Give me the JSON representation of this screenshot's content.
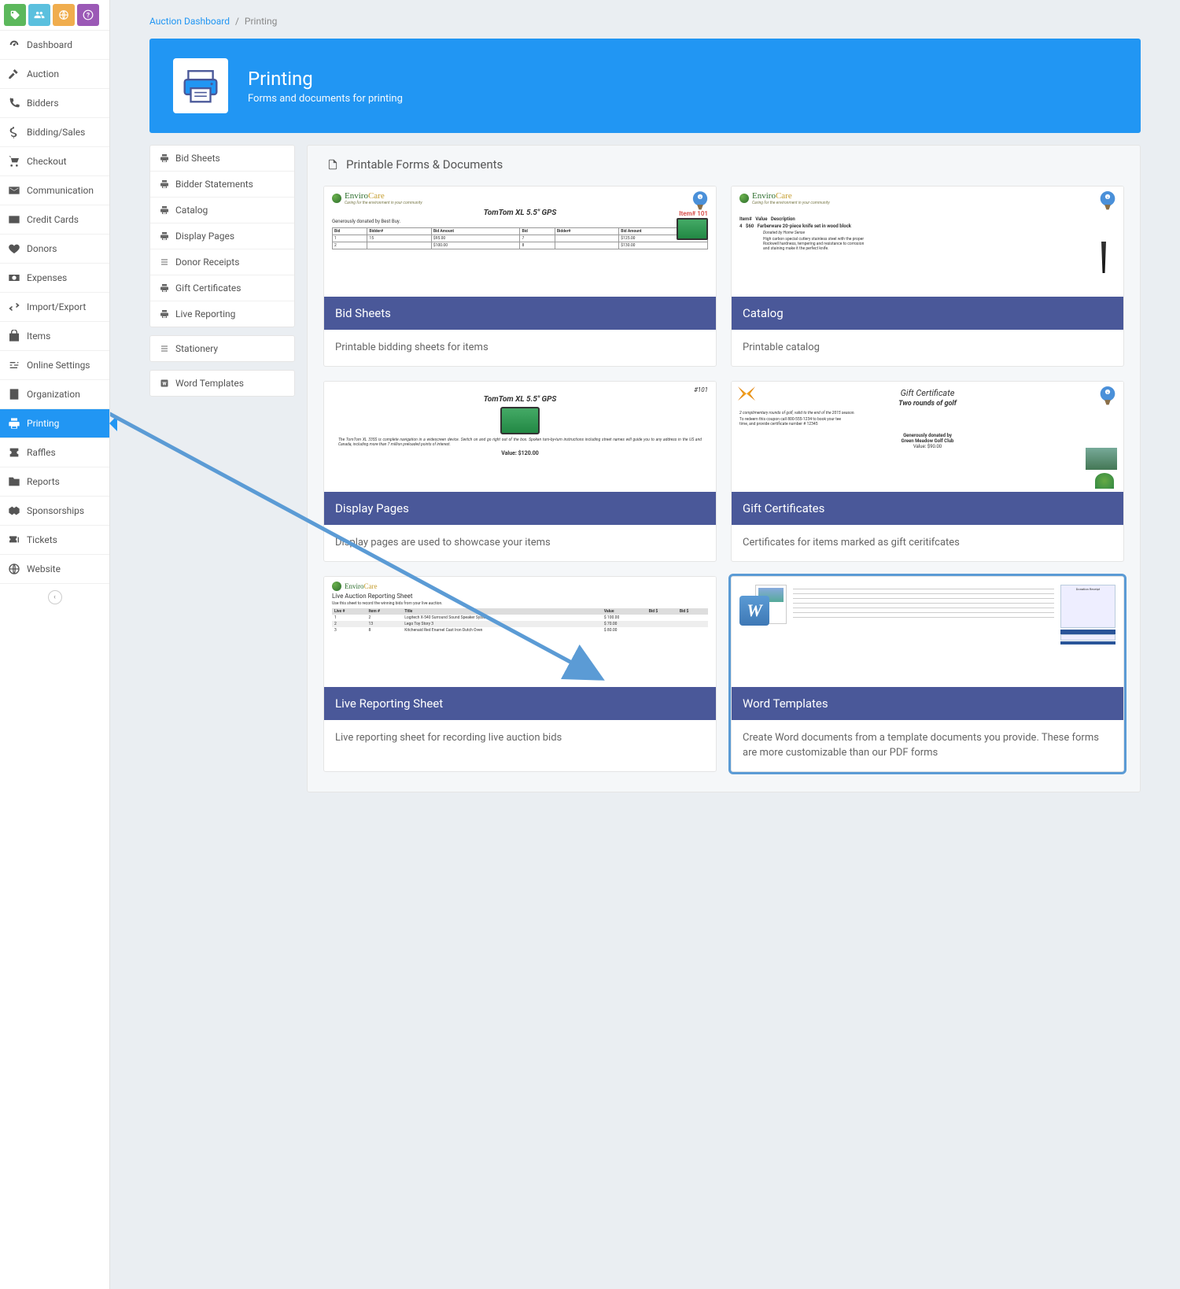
{
  "breadcrumb": {
    "root": "Auction Dashboard",
    "current": "Printing"
  },
  "banner": {
    "title": "Printing",
    "subtitle": "Forms and documents for printing"
  },
  "nav": [
    {
      "label": "Dashboard",
      "icon": "gauge"
    },
    {
      "label": "Auction",
      "icon": "gavel"
    },
    {
      "label": "Bidders",
      "icon": "phone"
    },
    {
      "label": "Bidding/Sales",
      "icon": "dollar"
    },
    {
      "label": "Checkout",
      "icon": "cart"
    },
    {
      "label": "Communication",
      "icon": "envelope"
    },
    {
      "label": "Credit Cards",
      "icon": "card"
    },
    {
      "label": "Donors",
      "icon": "heart"
    },
    {
      "label": "Expenses",
      "icon": "money"
    },
    {
      "label": "Import/Export",
      "icon": "exchange"
    },
    {
      "label": "Items",
      "icon": "bag"
    },
    {
      "label": "Online Settings",
      "icon": "sliders"
    },
    {
      "label": "Organization",
      "icon": "building"
    },
    {
      "label": "Printing",
      "icon": "print",
      "active": true
    },
    {
      "label": "Raffles",
      "icon": "ticket"
    },
    {
      "label": "Reports",
      "icon": "folder"
    },
    {
      "label": "Sponsorships",
      "icon": "handshake"
    },
    {
      "label": "Tickets",
      "icon": "tickets"
    },
    {
      "label": "Website",
      "icon": "globe"
    }
  ],
  "sidelinks_group1": [
    {
      "label": "Bid Sheets",
      "icon": "print"
    },
    {
      "label": "Bidder Statements",
      "icon": "print"
    },
    {
      "label": "Catalog",
      "icon": "print"
    },
    {
      "label": "Display Pages",
      "icon": "print"
    },
    {
      "label": "Donor Receipts",
      "icon": "list"
    },
    {
      "label": "Gift Certificates",
      "icon": "print"
    },
    {
      "label": "Live Reporting",
      "icon": "print"
    }
  ],
  "sidelinks_group2": [
    {
      "label": "Stationery",
      "icon": "list"
    }
  ],
  "sidelinks_group3": [
    {
      "label": "Word Templates",
      "icon": "word"
    }
  ],
  "cards_header": "Printable Forms & Documents",
  "cards": [
    {
      "title": "Bid Sheets",
      "desc": "Printable bidding sheets for items"
    },
    {
      "title": "Catalog",
      "desc": "Printable catalog"
    },
    {
      "title": "Display Pages",
      "desc": "Display pages are used to showcase your items"
    },
    {
      "title": "Gift Certificates",
      "desc": "Certificates for items marked as gift ceritifcates"
    },
    {
      "title": "Live Reporting Sheet",
      "desc": "Live reporting sheet for recording live auction bids"
    },
    {
      "title": "Word Templates",
      "desc": "Create Word documents from a template documents you provide. These forms are more customizable than our PDF forms",
      "highlighted": true
    }
  ],
  "previews": {
    "bid_sheets": {
      "brand": "EnviroCare",
      "tagline": "Caring for the environment in your community",
      "item_tag": "Item# 101",
      "product": "TomTom XL 5.5\" GPS",
      "donated": "Generously donated by Best Buy.",
      "table_headers": [
        "Bid",
        "Bidder#",
        "Bid Amount",
        "Bid",
        "Bidder#",
        "Bid Amount"
      ],
      "rows": [
        [
          "1",
          "15",
          "$95.00",
          "7",
          "",
          "$125.00"
        ],
        [
          "2",
          "",
          "$100.00",
          "8",
          "",
          "$130.00"
        ]
      ]
    },
    "catalog": {
      "brand": "EnviroCare",
      "tagline": "Caring for the environment in your community",
      "cols": [
        "Item#",
        "Value",
        "Description"
      ],
      "row": [
        "4",
        "$60",
        "Farberware 20-piece knife set in wood block"
      ],
      "donated": "Donated by Home Sense",
      "blurb": "High carbon special cutlery stainless steel with the proper Rockwell hardness, tempering and resistance to corrosion and staining make it the perfect knife."
    },
    "display": {
      "item_tag": "#101",
      "product": "TomTom XL 5.5\" GPS",
      "blurb": "The TomTom XL 335S is complete navigation in a widescreen device. Switch on and go right out of the box. Spoken turn-by-turn instructions including street names will guide you to any address in the US and Canada, including more than 7 million preloaded points of interest.",
      "value": "Value: $120.00"
    },
    "gift": {
      "title": "Gift Certificate",
      "subtitle": "Two rounds of golf",
      "terms": "2 complimentary rounds of golf, valid to the end of the 2015 season.",
      "redeem": "To redeem this coupon call 800-555-1234 to book your tee time, and provide certificate number # 12345",
      "donated_label": "Generously donated by",
      "donor": "Green Meadow Golf Club",
      "value": "Value: $90.00"
    },
    "live": {
      "brand": "EnviroCare",
      "title": "Live Auction Reporting Sheet",
      "instructions": "Use this sheet to record the winning bids from your live auction.",
      "cols": [
        "Live #",
        "Item #",
        "Title",
        "Value",
        "Bid $",
        "Bid $"
      ],
      "rows": [
        [
          "1",
          "2",
          "Logitech X-540 Surround Sound Speaker System",
          "$ 100.00",
          "",
          ""
        ],
        [
          "2",
          "13",
          "Lego Toy Story 3",
          "$ 70.00",
          "",
          ""
        ],
        [
          "3",
          "8",
          "Kitchenaid Red Enamel Cast Iron Dutch Oven",
          "$ 80.00",
          "",
          ""
        ]
      ]
    }
  }
}
